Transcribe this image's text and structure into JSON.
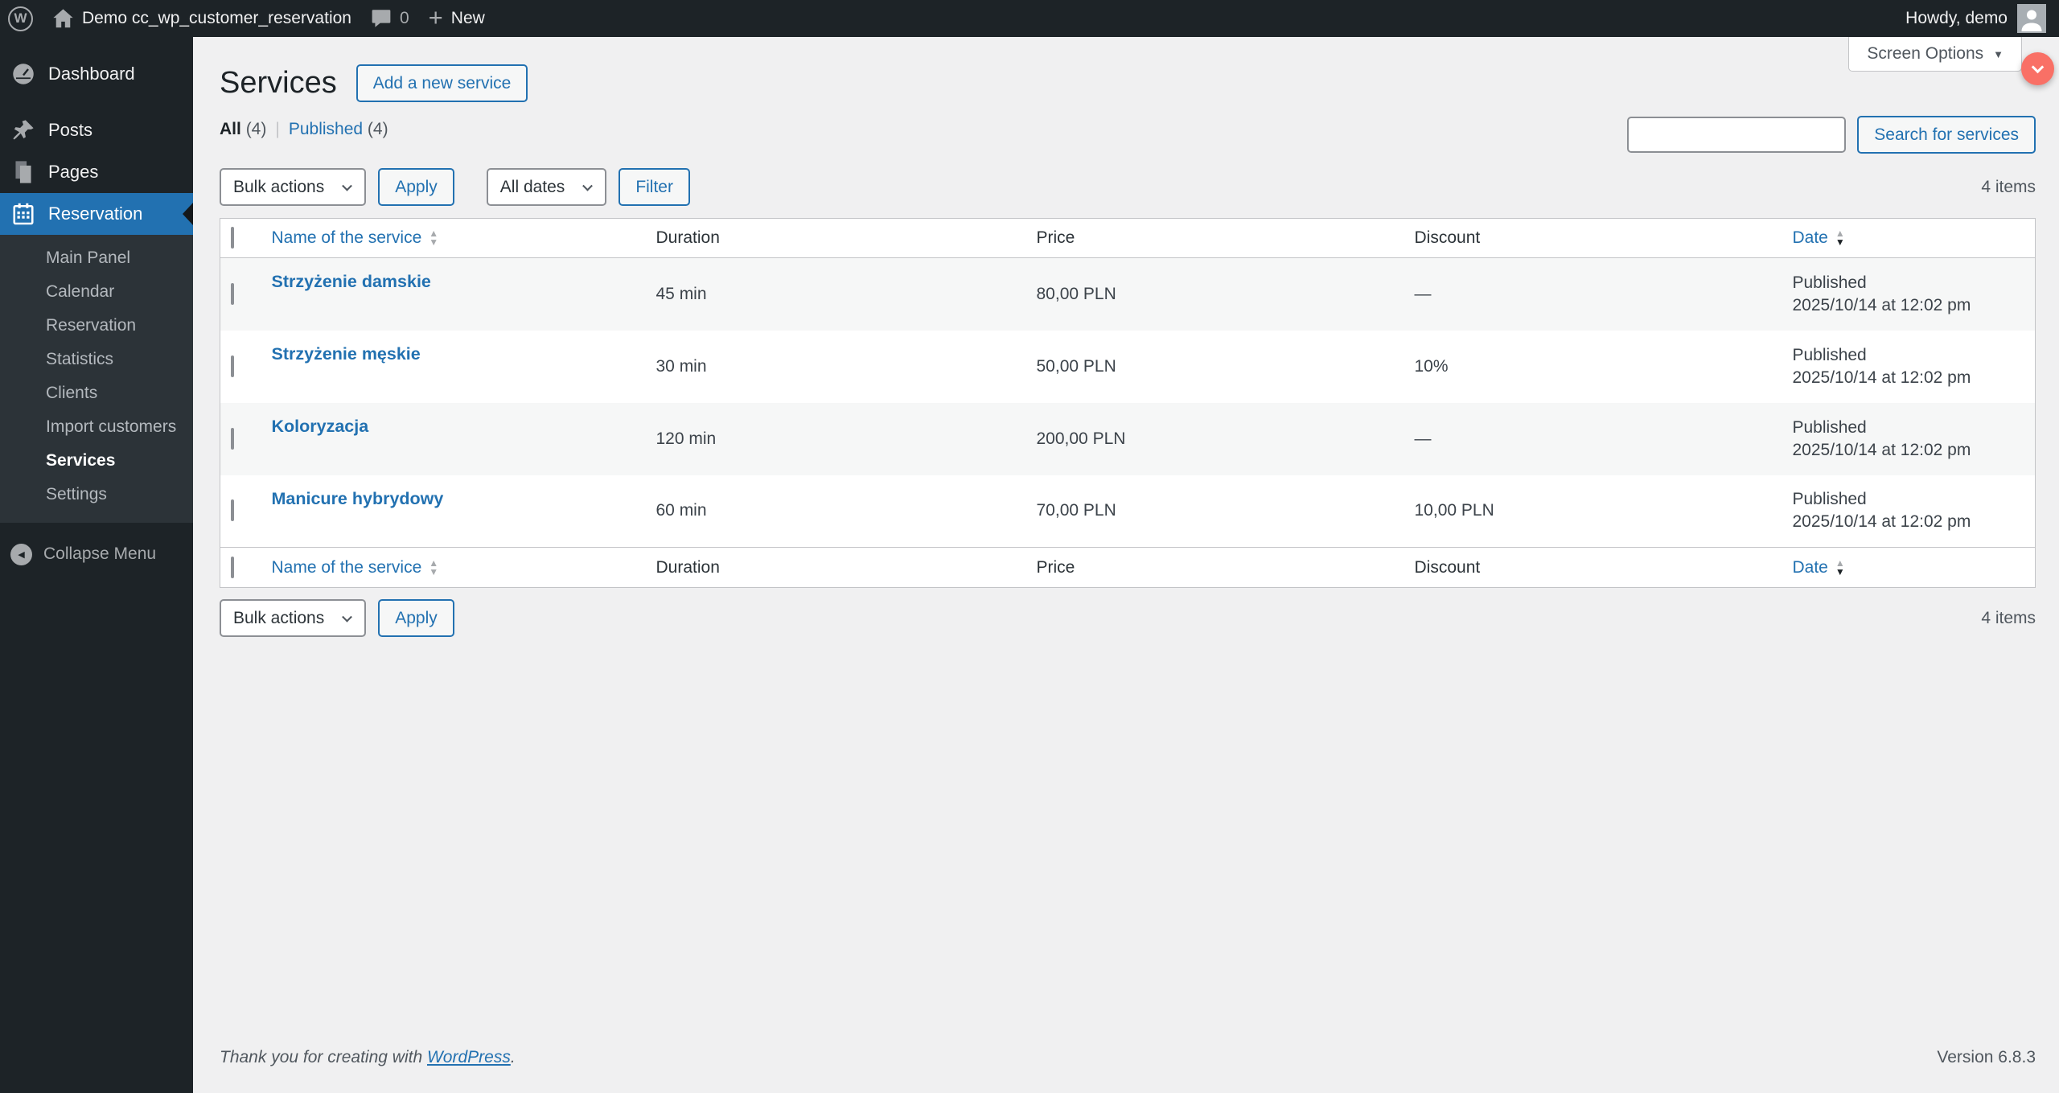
{
  "admin_bar": {
    "wp_logo_letter": "W",
    "site_name": "Demo cc_wp_customer_reservation",
    "comments_count": "0",
    "new_label": "New",
    "howdy": "Howdy, demo"
  },
  "screen_options": {
    "label": "Screen Options"
  },
  "sidebar": {
    "items": [
      "Dashboard",
      "Posts",
      "Pages",
      "Reservation"
    ],
    "submenu": [
      "Main Panel",
      "Calendar",
      "Reservation",
      "Statistics",
      "Clients",
      "Import customers",
      "Services",
      "Settings"
    ],
    "collapse_label": "Collapse Menu"
  },
  "page": {
    "title": "Services",
    "add_button_label": "Add a new service",
    "views": {
      "all_label": "All",
      "all_count": "(4)",
      "separator": "|",
      "published_label": "Published",
      "published_count": "(4)"
    },
    "toolbar": {
      "bulk_actions": "Bulk actions",
      "apply": "Apply",
      "all_dates": "All dates",
      "filter": "Filter"
    },
    "search": {
      "button_label": "Search for services",
      "value": ""
    },
    "items_count": "4 items"
  },
  "table": {
    "columns": {
      "name": "Name of the service",
      "duration": "Duration",
      "price": "Price",
      "discount": "Discount",
      "date": "Date"
    },
    "rows": [
      {
        "name": "Strzyżenie damskie",
        "duration": "45 min",
        "price": "80,00 PLN",
        "discount": "—",
        "status": "Published",
        "datetime": "2025/10/14 at 12:02 pm"
      },
      {
        "name": "Strzyżenie męskie",
        "duration": "30 min",
        "price": "50,00 PLN",
        "discount": "10%",
        "status": "Published",
        "datetime": "2025/10/14 at 12:02 pm"
      },
      {
        "name": "Koloryzacja",
        "duration": "120 min",
        "price": "200,00 PLN",
        "discount": "—",
        "status": "Published",
        "datetime": "2025/10/14 at 12:02 pm"
      },
      {
        "name": "Manicure hybrydowy",
        "duration": "60 min",
        "price": "70,00 PLN",
        "discount": "10,00 PLN",
        "status": "Published",
        "datetime": "2025/10/14 at 12:02 pm"
      }
    ]
  },
  "footer": {
    "thanks_text": "Thank you for creating with",
    "wordpress_link": "WordPress",
    "suffix": ".",
    "version": "Version 6.8.3"
  },
  "colors": {
    "accent": "#2271b1",
    "admin_dark": "#1d2327",
    "submenu_bg": "#2c3338",
    "content_bg": "#f0f0f1",
    "row_alt": "#f6f7f7",
    "border": "#c3c4c7",
    "fab": "#f97066"
  }
}
